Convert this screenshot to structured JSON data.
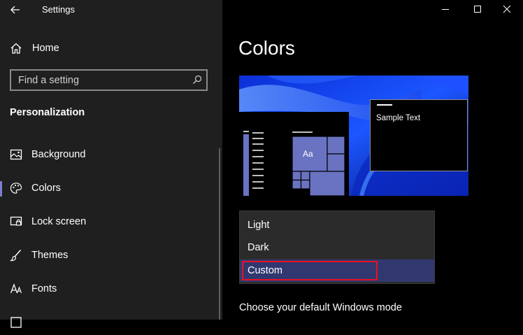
{
  "window": {
    "title": "Settings",
    "controls": {
      "minimize_icon": "minimize-icon",
      "maximize_icon": "maximize-icon",
      "close_icon": "close-icon"
    }
  },
  "sidebar": {
    "home_label": "Home",
    "search": {
      "placeholder": "Find a setting",
      "value": ""
    },
    "section_title": "Personalization",
    "items": [
      {
        "label": "Background",
        "icon": "image-icon",
        "selected": false
      },
      {
        "label": "Colors",
        "icon": "palette-icon",
        "selected": true
      },
      {
        "label": "Lock screen",
        "icon": "lock-screen-icon",
        "selected": false
      },
      {
        "label": "Themes",
        "icon": "brush-icon",
        "selected": false
      },
      {
        "label": "Fonts",
        "icon": "font-icon",
        "selected": false
      }
    ]
  },
  "main": {
    "title": "Colors",
    "preview": {
      "tile_text": "Aa",
      "sample_text": "Sample Text"
    },
    "mode_dropdown": {
      "options": [
        "Light",
        "Dark",
        "Custom"
      ],
      "selected": "Custom"
    },
    "caption": "Choose your default Windows mode"
  },
  "colors": {
    "accent": "#7b7fd0",
    "selected_option_bg": "#313870",
    "highlight_border": "#e81123",
    "tile": "#6a73c2"
  }
}
